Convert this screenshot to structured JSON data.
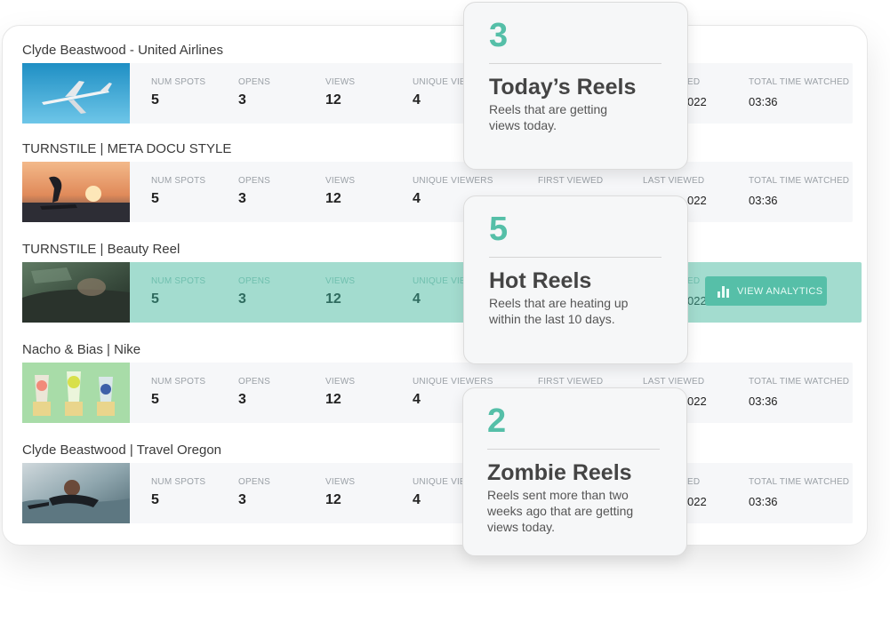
{
  "labels": {
    "num_spots": "NUM SPOTS",
    "opens": "OPENS",
    "views": "VIEWS",
    "unique_viewers": "UNIQUE VIEWERS",
    "unique_viewers_truncated": "UNIQUE VIEW",
    "first_viewed": "FIRST VIEWED",
    "last_viewed": "LAST VIEWED",
    "last_viewed_truncated": "ED",
    "total_time_watched": "TOTAL TIME WATCHED"
  },
  "reels": [
    {
      "title": "Clyde Beastwood - United Airlines",
      "num_spots": "5",
      "opens": "3",
      "views": "12",
      "unique_viewers": "4",
      "last_viewed_partial": "022",
      "total_time": "03:36"
    },
    {
      "title": "TURNSTILE | META DOCU STYLE",
      "num_spots": "5",
      "opens": "3",
      "views": "12",
      "unique_viewers": "4",
      "last_viewed_partial": "022",
      "total_time": "03:36"
    },
    {
      "title": "TURNSTILE | Beauty Reel",
      "num_spots": "5",
      "opens": "3",
      "views": "12",
      "unique_viewers": "4",
      "last_viewed_partial": "022",
      "total_time": "",
      "action": "VIEW ANALYTICS"
    },
    {
      "title": "Nacho & Bias | Nike",
      "num_spots": "5",
      "opens": "3",
      "views": "12",
      "unique_viewers": "4",
      "last_viewed_partial": "022",
      "total_time": "03:36"
    },
    {
      "title": "Clyde Beastwood | Travel Oregon",
      "num_spots": "5",
      "opens": "3",
      "views": "12",
      "unique_viewers": "4",
      "last_viewed_partial": "022",
      "total_time": "03:36"
    }
  ],
  "cards": [
    {
      "count": "3",
      "title": "Today’s Reels",
      "desc_1": "Reels that are getting",
      "desc_2": "views today.",
      "desc_3": ""
    },
    {
      "count": "5",
      "title": "Hot Reels",
      "desc_1": "Reels that are heating up",
      "desc_2": "within the last 10 days.",
      "desc_3": ""
    },
    {
      "count": "2",
      "title": "Zombie Reels",
      "desc_1": "Reels sent more than two",
      "desc_2": "weeks ago that are getting",
      "desc_3": "views today."
    }
  ],
  "colors": {
    "accent": "#55bfa8",
    "highlight_row": "#a3dccf",
    "row_bg": "#f6f7f9",
    "card_bg": "#f6f7f8"
  },
  "icons": {
    "analytics": "bar-chart-icon"
  }
}
